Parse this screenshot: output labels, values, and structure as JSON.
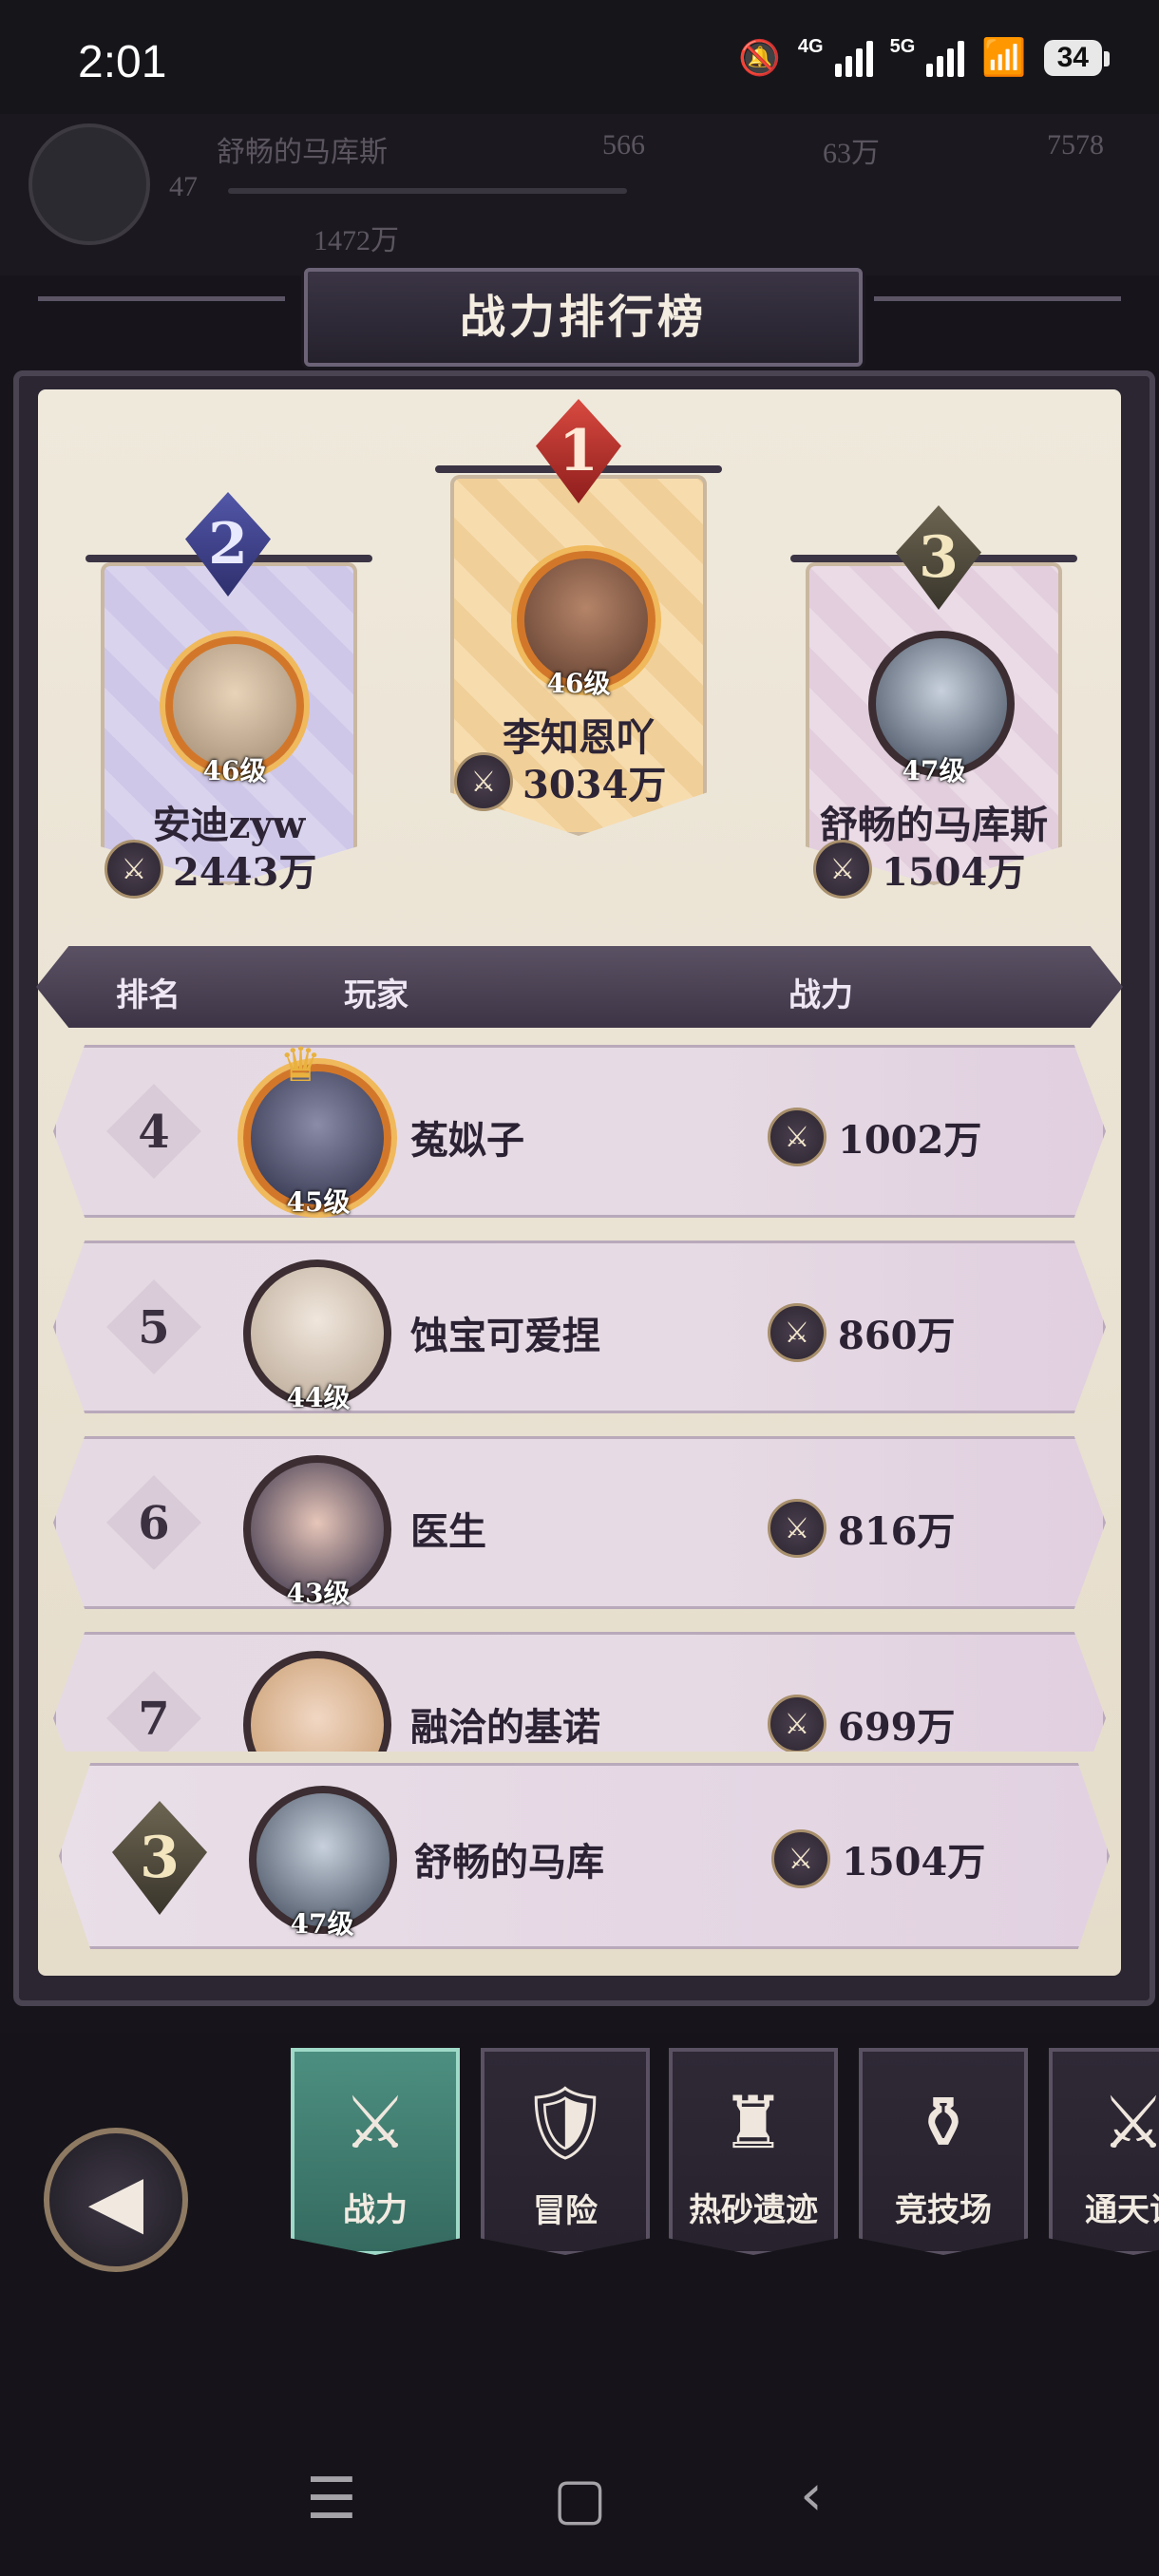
{
  "status_bar": {
    "time": "2:01",
    "net_4g": "4G",
    "net_5g": "5G",
    "battery": "34"
  },
  "background_header": {
    "player_name": "舒畅的马库斯",
    "level": "47",
    "res1": "566",
    "res2": "63万",
    "res3": "7578",
    "power": "1472万"
  },
  "title": "战力排行榜",
  "podium": [
    {
      "rank": "2",
      "level": "46级",
      "name": "安迪zyw",
      "power": "2443万"
    },
    {
      "rank": "1",
      "level": "46级",
      "name": "李知恩吖",
      "power": "3034万"
    },
    {
      "rank": "3",
      "level": "47级",
      "name": "舒畅的马库斯",
      "power": "1504万"
    }
  ],
  "table_header": {
    "rank": "排名",
    "player": "玩家",
    "power": "战力"
  },
  "rows": [
    {
      "rank": "4",
      "level": "45级",
      "name": "菟姒子",
      "power": "1002万"
    },
    {
      "rank": "5",
      "level": "44级",
      "name": "蚀宝可爱捏",
      "power": "860万"
    },
    {
      "rank": "6",
      "level": "43级",
      "name": "医生",
      "power": "816万"
    },
    {
      "rank": "7",
      "level": "",
      "name": "融洽的基诺",
      "power": "699万"
    }
  ],
  "my_row": {
    "rank": "3",
    "level": "47级",
    "name": "舒畅的马库",
    "power": "1504万"
  },
  "tabs": [
    {
      "label": "战力",
      "icon": "crossed-swords-icon",
      "active": true
    },
    {
      "label": "冒险",
      "icon": "shield-sword-icon",
      "active": false
    },
    {
      "label": "热砂遗迹",
      "icon": "tower-icon",
      "active": false
    },
    {
      "label": "竞技场",
      "icon": "sword-pedestal-icon",
      "active": false
    },
    {
      "label": "通天试",
      "icon": "blades-icon",
      "active": false
    }
  ],
  "colors": {
    "accent_tab": "#4c8f80",
    "panel_bg": "#efe9dc",
    "gold": "#f0cf98",
    "lavender": "#d9d3ee",
    "pink": "#eadbe6"
  }
}
